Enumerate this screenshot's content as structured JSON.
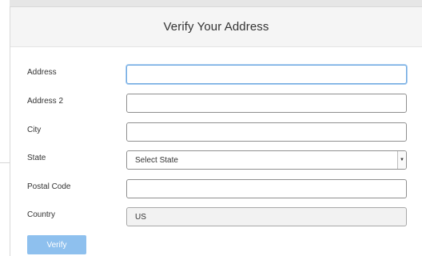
{
  "modal": {
    "title": "Verify Your Address"
  },
  "form": {
    "address": {
      "label": "Address",
      "value": ""
    },
    "address2": {
      "label": "Address 2",
      "value": ""
    },
    "city": {
      "label": "City",
      "value": ""
    },
    "state": {
      "label": "State",
      "selected": "Select State",
      "arrow_icon": "caret-down-icon"
    },
    "postal_code": {
      "label": "Postal Code",
      "value": ""
    },
    "country": {
      "label": "Country",
      "value": "US"
    }
  },
  "actions": {
    "verify_label": "Verify",
    "verify_color": "#8ec0ee"
  },
  "colors": {
    "focus_border": "#6ea8e0",
    "header_bg": "#f5f5f5"
  }
}
